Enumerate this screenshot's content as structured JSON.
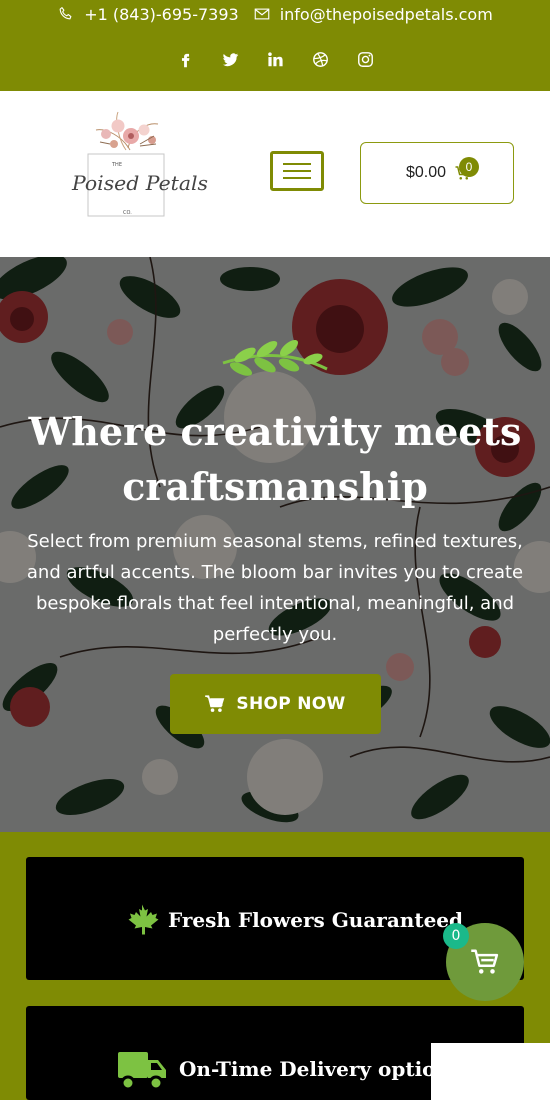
{
  "topbar": {
    "phone": "+1 (843)-695-7393",
    "email": "info@thepoisedpetals.com",
    "socials": [
      "facebook-icon",
      "twitter-icon",
      "linkedin-icon",
      "dribbble-icon",
      "instagram-icon"
    ],
    "color": "#7f8b04"
  },
  "header": {
    "logo": {
      "top": "THE",
      "name": "Poised Petals",
      "bottom": "CO."
    },
    "cart_total": "$0.00",
    "cart_count": "0"
  },
  "hero": {
    "title": "Where creativity meets craftsmanship",
    "text": "Select from premium seasonal stems, refined textures, and artful accents. The bloom bar invites you to create bespoke florals that feel intentional, meaningful, and perfectly you.",
    "button": "SHOP NOW"
  },
  "features": [
    {
      "icon": "maple-leaf-icon",
      "label": "Fresh Flowers Guaranteed"
    },
    {
      "icon": "delivery-truck-icon",
      "label": "On-Time Delivery option"
    }
  ],
  "floating_cart": {
    "count": "0"
  }
}
